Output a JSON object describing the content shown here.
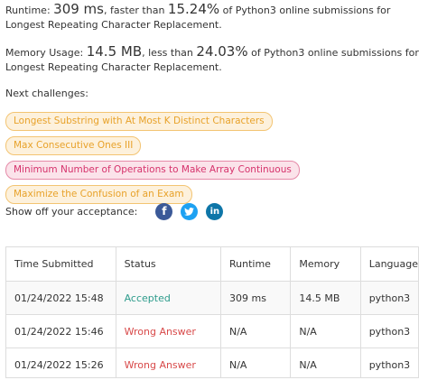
{
  "runtime": {
    "label": "Runtime: ",
    "value": "309 ms",
    "faster_than_text": ", faster than ",
    "percent": "15.24%",
    "suffix": " of Python3 online submissions for Longest Repeating Character Replacement."
  },
  "memory": {
    "label": "Memory Usage: ",
    "value": "14.5 MB",
    "less_than_text": ", less than ",
    "percent": "24.03%",
    "suffix": " of Python3 online submissions for Longest Repeating Character Replacement."
  },
  "next_challenges": {
    "label": "Next challenges:",
    "items": [
      {
        "title": "Longest Substring with At Most K Distinct Characters",
        "difficulty": "medium"
      },
      {
        "title": "Max Consecutive Ones III",
        "difficulty": "medium"
      },
      {
        "title": "Minimum Number of Operations to Make Array Continuous",
        "difficulty": "hard"
      },
      {
        "title": "Maximize the Confusion of an Exam",
        "difficulty": "medium"
      }
    ]
  },
  "share": {
    "label": "Show off your acceptance:",
    "icons": [
      "facebook-icon",
      "twitter-icon",
      "linkedin-icon"
    ]
  },
  "submissions": {
    "headers": [
      "Time Submitted",
      "Status",
      "Runtime",
      "Memory",
      "Language"
    ],
    "rows": [
      {
        "time": "01/24/2022 15:48",
        "status": "Accepted",
        "runtime": "309 ms",
        "memory": "14.5 MB",
        "language": "python3"
      },
      {
        "time": "01/24/2022 15:46",
        "status": "Wrong Answer",
        "runtime": "N/A",
        "memory": "N/A",
        "language": "python3"
      },
      {
        "time": "01/24/2022 15:26",
        "status": "Wrong Answer",
        "runtime": "N/A",
        "memory": "N/A",
        "language": "python3"
      }
    ]
  },
  "colors": {
    "accepted": "#2e9c8c",
    "wrong_answer": "#d84a4a",
    "medium": "#e8a22a",
    "hard": "#d6336c"
  }
}
